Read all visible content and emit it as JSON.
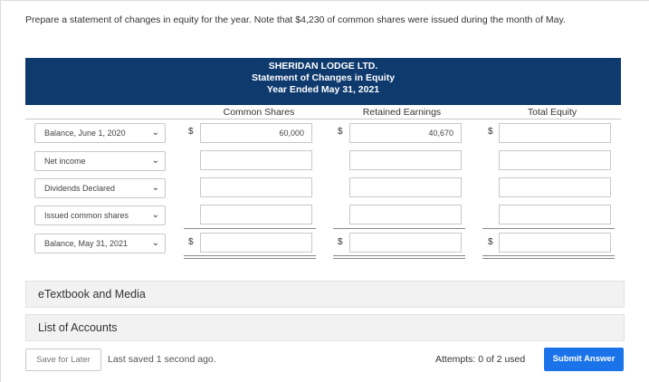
{
  "question": "Prepare a statement of changes in equity for the year. Note that $4,230 of common shares were issued during the month of May.",
  "statement": {
    "company": "SHERIDAN LODGE LTD.",
    "title": "Statement of Changes in Equity",
    "period": "Year Ended May 31, 2021",
    "columns": [
      "Common Shares",
      "Retained Earnings",
      "Total Equity"
    ],
    "currency_symbol": "$",
    "rows": [
      {
        "label": "Balance, June 1, 2020",
        "common_shares": "60,000",
        "retained_earnings": "40,670",
        "total_equity": ""
      },
      {
        "label": "Net income",
        "common_shares": "",
        "retained_earnings": "",
        "total_equity": ""
      },
      {
        "label": "Dividends Declared",
        "common_shares": "",
        "retained_earnings": "",
        "total_equity": ""
      },
      {
        "label": "Issued common shares",
        "common_shares": "",
        "retained_earnings": "",
        "total_equity": ""
      },
      {
        "label": "Balance, May 31, 2021",
        "common_shares": "",
        "retained_earnings": "",
        "total_equity": ""
      }
    ]
  },
  "panels": {
    "etextbook": "eTextbook and Media",
    "accounts": "List of Accounts"
  },
  "footer": {
    "save_label": "Save for Later",
    "saved_status": "Last saved 1 second ago.",
    "attempts": "Attempts: 0 of 2 used",
    "submit_label": "Submit Answer"
  },
  "colors": {
    "header_bg": "#0e3a6e",
    "submit_bg": "#1a73e8"
  }
}
